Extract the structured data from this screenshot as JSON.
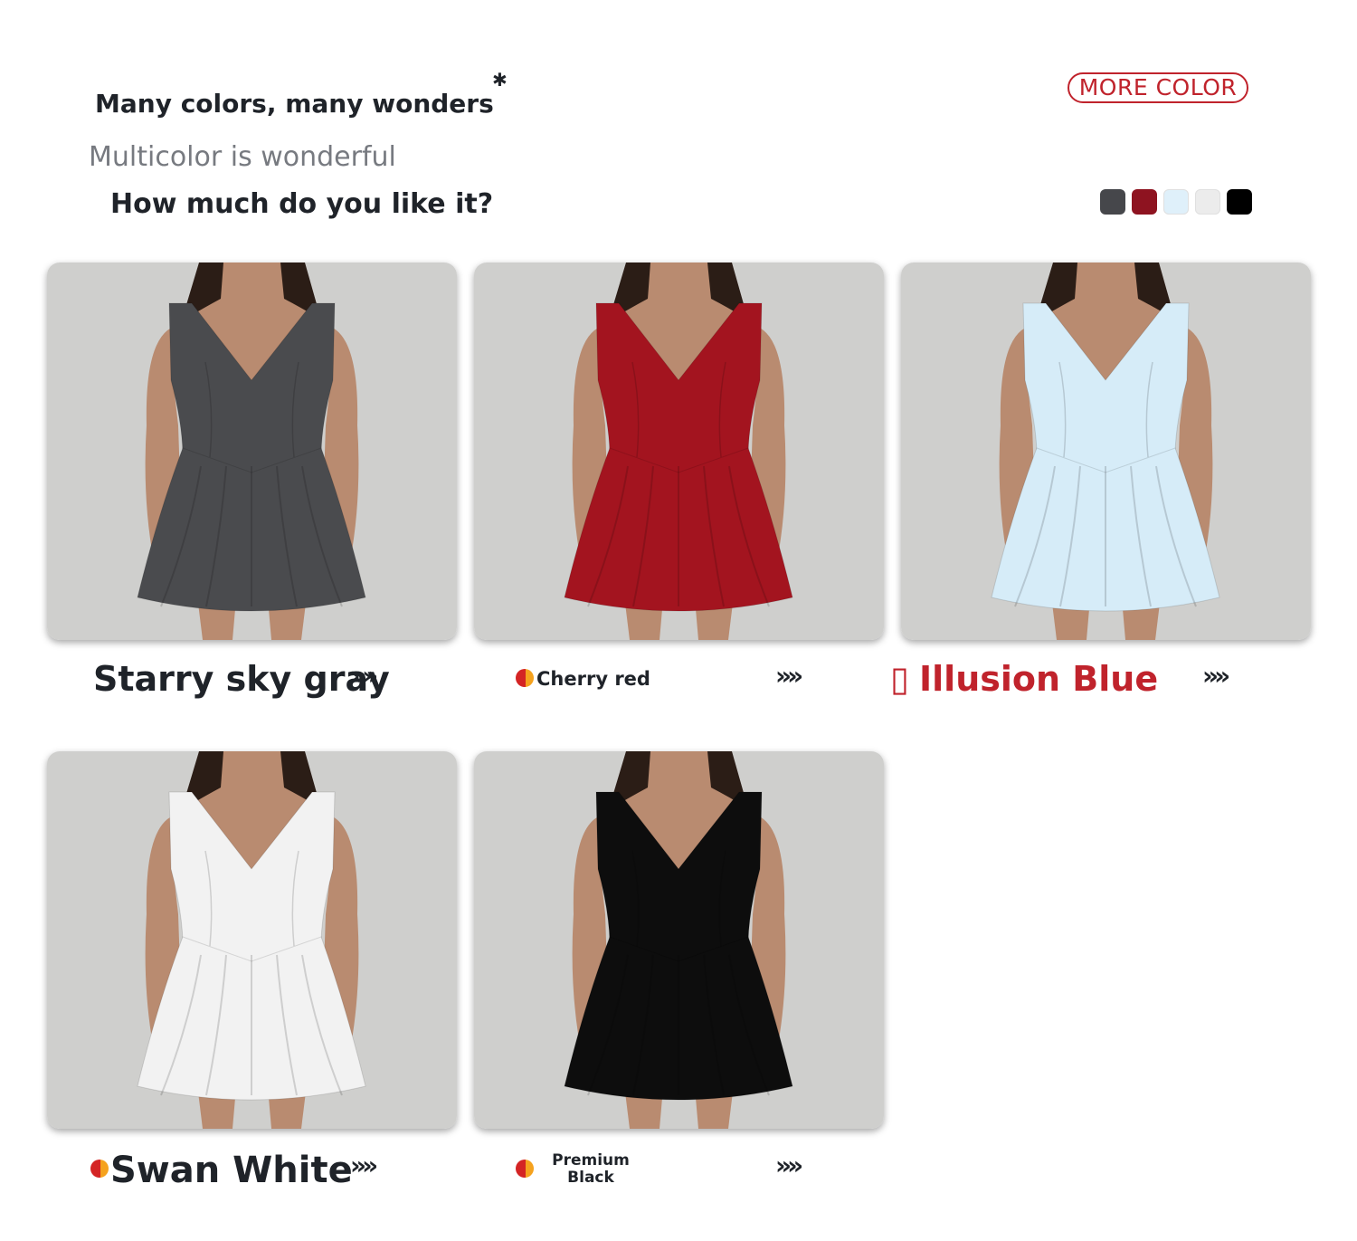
{
  "header": {
    "headline": "Many colors, many wonders",
    "asterisk": "✱",
    "subline": "Multicolor is wonderful",
    "question": "How much do you like it?",
    "more_button": "MORE COLOR"
  },
  "swatches": [
    {
      "name": "swatch-gray",
      "color": "#46474b"
    },
    {
      "name": "swatch-red",
      "color": "#8e1320"
    },
    {
      "name": "swatch-blue",
      "color": "#dff0fa"
    },
    {
      "name": "swatch-white",
      "color": "#ececec"
    },
    {
      "name": "swatch-black",
      "color": "#000000"
    }
  ],
  "products": [
    {
      "label": "Starry sky gray",
      "dress_color": "#4a4b4e",
      "arrows": "››››"
    },
    {
      "label": "Cherry red",
      "dress_color": "#a3141f",
      "arrows": "››››"
    },
    {
      "label": "Illusion Blue",
      "icon_glyph": "▯",
      "dress_color": "#d6ecf8",
      "arrows": "››››"
    },
    {
      "label": "Swan White",
      "dress_color": "#f2f2f2",
      "arrows": "››››"
    },
    {
      "label_line1": "Premium",
      "label_line2": "Black",
      "dress_color": "#0d0d0d",
      "arrows": "››››"
    }
  ],
  "colors": {
    "accent_red": "#c0232c",
    "card_background": "#cfcfcd",
    "skin": "#b98b70"
  }
}
